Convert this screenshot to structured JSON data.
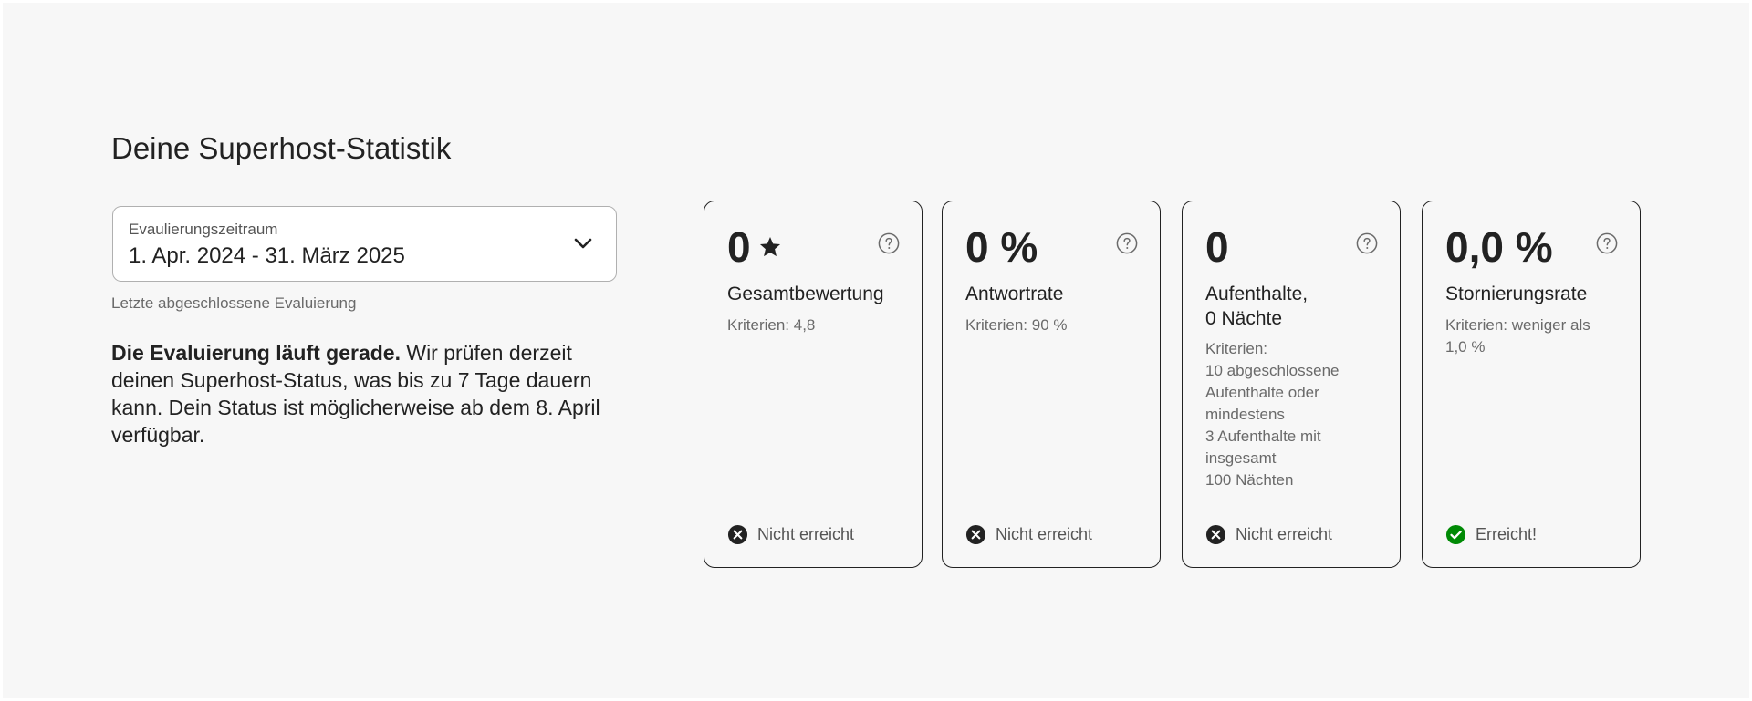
{
  "page": {
    "title": "Deine Superhost-Statistik"
  },
  "evaluation_period": {
    "label": "Evaulierungszeitraum",
    "value": "1. Apr. 2024 - 31. März 2025",
    "note": "Letzte abgeschlossene Evaluierung"
  },
  "evaluation_message": {
    "bold": "Die Evaluierung läuft gerade.",
    "text": " Wir prüfen derzeit deinen Superhost-Status, was bis zu 7 Tage dauern kann. Dein Status ist möglicherweise ab dem 8. April verfügbar."
  },
  "cards": [
    {
      "metric": "0",
      "metric_icon": "star-icon",
      "title_lines": [
        "Gesamtbewertung"
      ],
      "criteria_lines": [
        "Kriterien: 4,8"
      ],
      "status": "Nicht erreicht",
      "status_icon": "x-circle-icon",
      "achieved": false
    },
    {
      "metric": "0 %",
      "title_lines": [
        "Antwortrate"
      ],
      "criteria_lines": [
        "Kriterien: 90 %"
      ],
      "status": "Nicht erreicht",
      "status_icon": "x-circle-icon",
      "achieved": false
    },
    {
      "metric": "0",
      "title_lines": [
        "Aufenthalte,",
        "0 Nächte"
      ],
      "criteria_lines": [
        "Kriterien:",
        "10 abgeschlossene",
        "Aufenthalte oder",
        "mindestens",
        "3 Aufenthalte mit",
        "insgesamt",
        "100 Nächten"
      ],
      "status": "Nicht erreicht",
      "status_icon": "x-circle-icon",
      "achieved": false
    },
    {
      "metric": "0,0 %",
      "title_lines": [
        "Stornierungsrate"
      ],
      "criteria_lines": [
        "Kriterien: weniger als",
        "1,0 %"
      ],
      "status": "Erreicht!",
      "status_icon": "check-circle-icon",
      "achieved": true
    }
  ],
  "colors": {
    "background": "#f7f7f7",
    "text": "#222222",
    "secondary_text": "#6a6a6a",
    "not_achieved": "#222222",
    "achieved": "#008a05"
  }
}
